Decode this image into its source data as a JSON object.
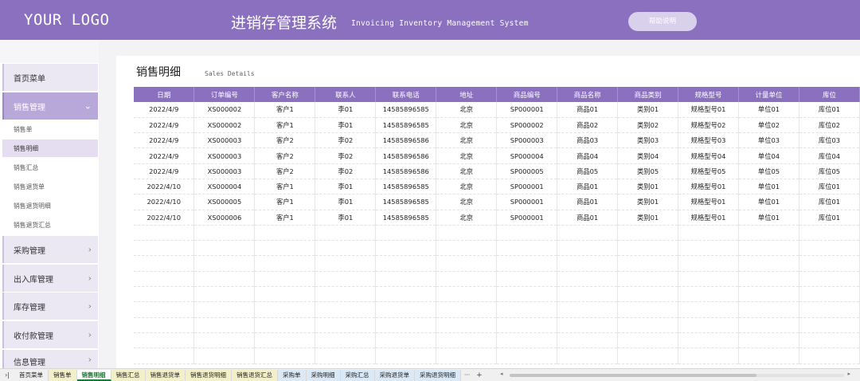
{
  "header": {
    "logo": "YOUR LOGO",
    "title": "进销存管理系统",
    "subtitle": "Invoicing Inventory Management System",
    "help_label": "帮助说明"
  },
  "sidebar": {
    "home": "首页菜单",
    "sales": "销售管理",
    "sales_subs": [
      "销售单",
      "销售明细",
      "销售汇总",
      "销售退货单",
      "销售退货明细",
      "销售退货汇总"
    ],
    "purchase": "采购管理",
    "inout": "出入库管理",
    "stock": "库存管理",
    "payment": "收付款管理",
    "info": "信息管理",
    "chevron_right": "›",
    "chevron_down": "⌄"
  },
  "page": {
    "title": "销售明细",
    "subtitle": "Sales Details"
  },
  "table": {
    "columns": [
      "日期",
      "订单编号",
      "客户名称",
      "联系人",
      "联系电话",
      "地址",
      "商品编号",
      "商品名称",
      "商品类别",
      "规格型号",
      "计量单位",
      "库位"
    ],
    "rows": [
      [
        "2022/4/9",
        "XS000002",
        "客户1",
        "李01",
        "14585896585",
        "北京",
        "SP000001",
        "商品01",
        "类别01",
        "规格型号01",
        "单位01",
        "库位01"
      ],
      [
        "2022/4/9",
        "XS000002",
        "客户1",
        "李01",
        "14585896585",
        "北京",
        "SP000002",
        "商品02",
        "类别02",
        "规格型号02",
        "单位02",
        "库位02"
      ],
      [
        "2022/4/9",
        "XS000003",
        "客户2",
        "李02",
        "14585896586",
        "北京",
        "SP000003",
        "商品03",
        "类别03",
        "规格型号03",
        "单位03",
        "库位03"
      ],
      [
        "2022/4/9",
        "XS000003",
        "客户2",
        "李02",
        "14585896586",
        "北京",
        "SP000004",
        "商品04",
        "类别04",
        "规格型号04",
        "单位04",
        "库位04"
      ],
      [
        "2022/4/9",
        "XS000003",
        "客户2",
        "李02",
        "14585896586",
        "北京",
        "SP000005",
        "商品05",
        "类别05",
        "规格型号05",
        "单位05",
        "库位05"
      ],
      [
        "2022/4/10",
        "XS000004",
        "客户1",
        "李01",
        "14585896585",
        "北京",
        "SP000001",
        "商品01",
        "类别01",
        "规格型号01",
        "单位01",
        "库位01"
      ],
      [
        "2022/4/10",
        "XS000005",
        "客户1",
        "李01",
        "14585896585",
        "北京",
        "SP000001",
        "商品01",
        "类别01",
        "规格型号01",
        "单位01",
        "库位01"
      ],
      [
        "2022/4/10",
        "XS000006",
        "客户1",
        "李01",
        "14585896585",
        "北京",
        "SP000001",
        "商品01",
        "类别01",
        "规格型号01",
        "单位01",
        "库位01"
      ]
    ],
    "empty_rows": 9
  },
  "sheet_tabs": {
    "nav": "›|",
    "tabs": [
      {
        "label": "首页菜单",
        "color": "none"
      },
      {
        "label": "销售单",
        "color": "yellow"
      },
      {
        "label": "销售明细",
        "color": "active"
      },
      {
        "label": "销售汇总",
        "color": "yellow"
      },
      {
        "label": "销售退货单",
        "color": "yellow"
      },
      {
        "label": "销售退货明细",
        "color": "yellow"
      },
      {
        "label": "销售退货汇总",
        "color": "yellow"
      },
      {
        "label": "采购单",
        "color": "blue"
      },
      {
        "label": "采购明细",
        "color": "blue"
      },
      {
        "label": "采购汇总",
        "color": "blue"
      },
      {
        "label": "采购退货单",
        "color": "blue"
      },
      {
        "label": "采购退货明细",
        "color": "blue"
      }
    ],
    "more": "···",
    "add": "+"
  },
  "colors": {
    "brand": "#8a70bf",
    "active_tab": "#1a7a35"
  }
}
